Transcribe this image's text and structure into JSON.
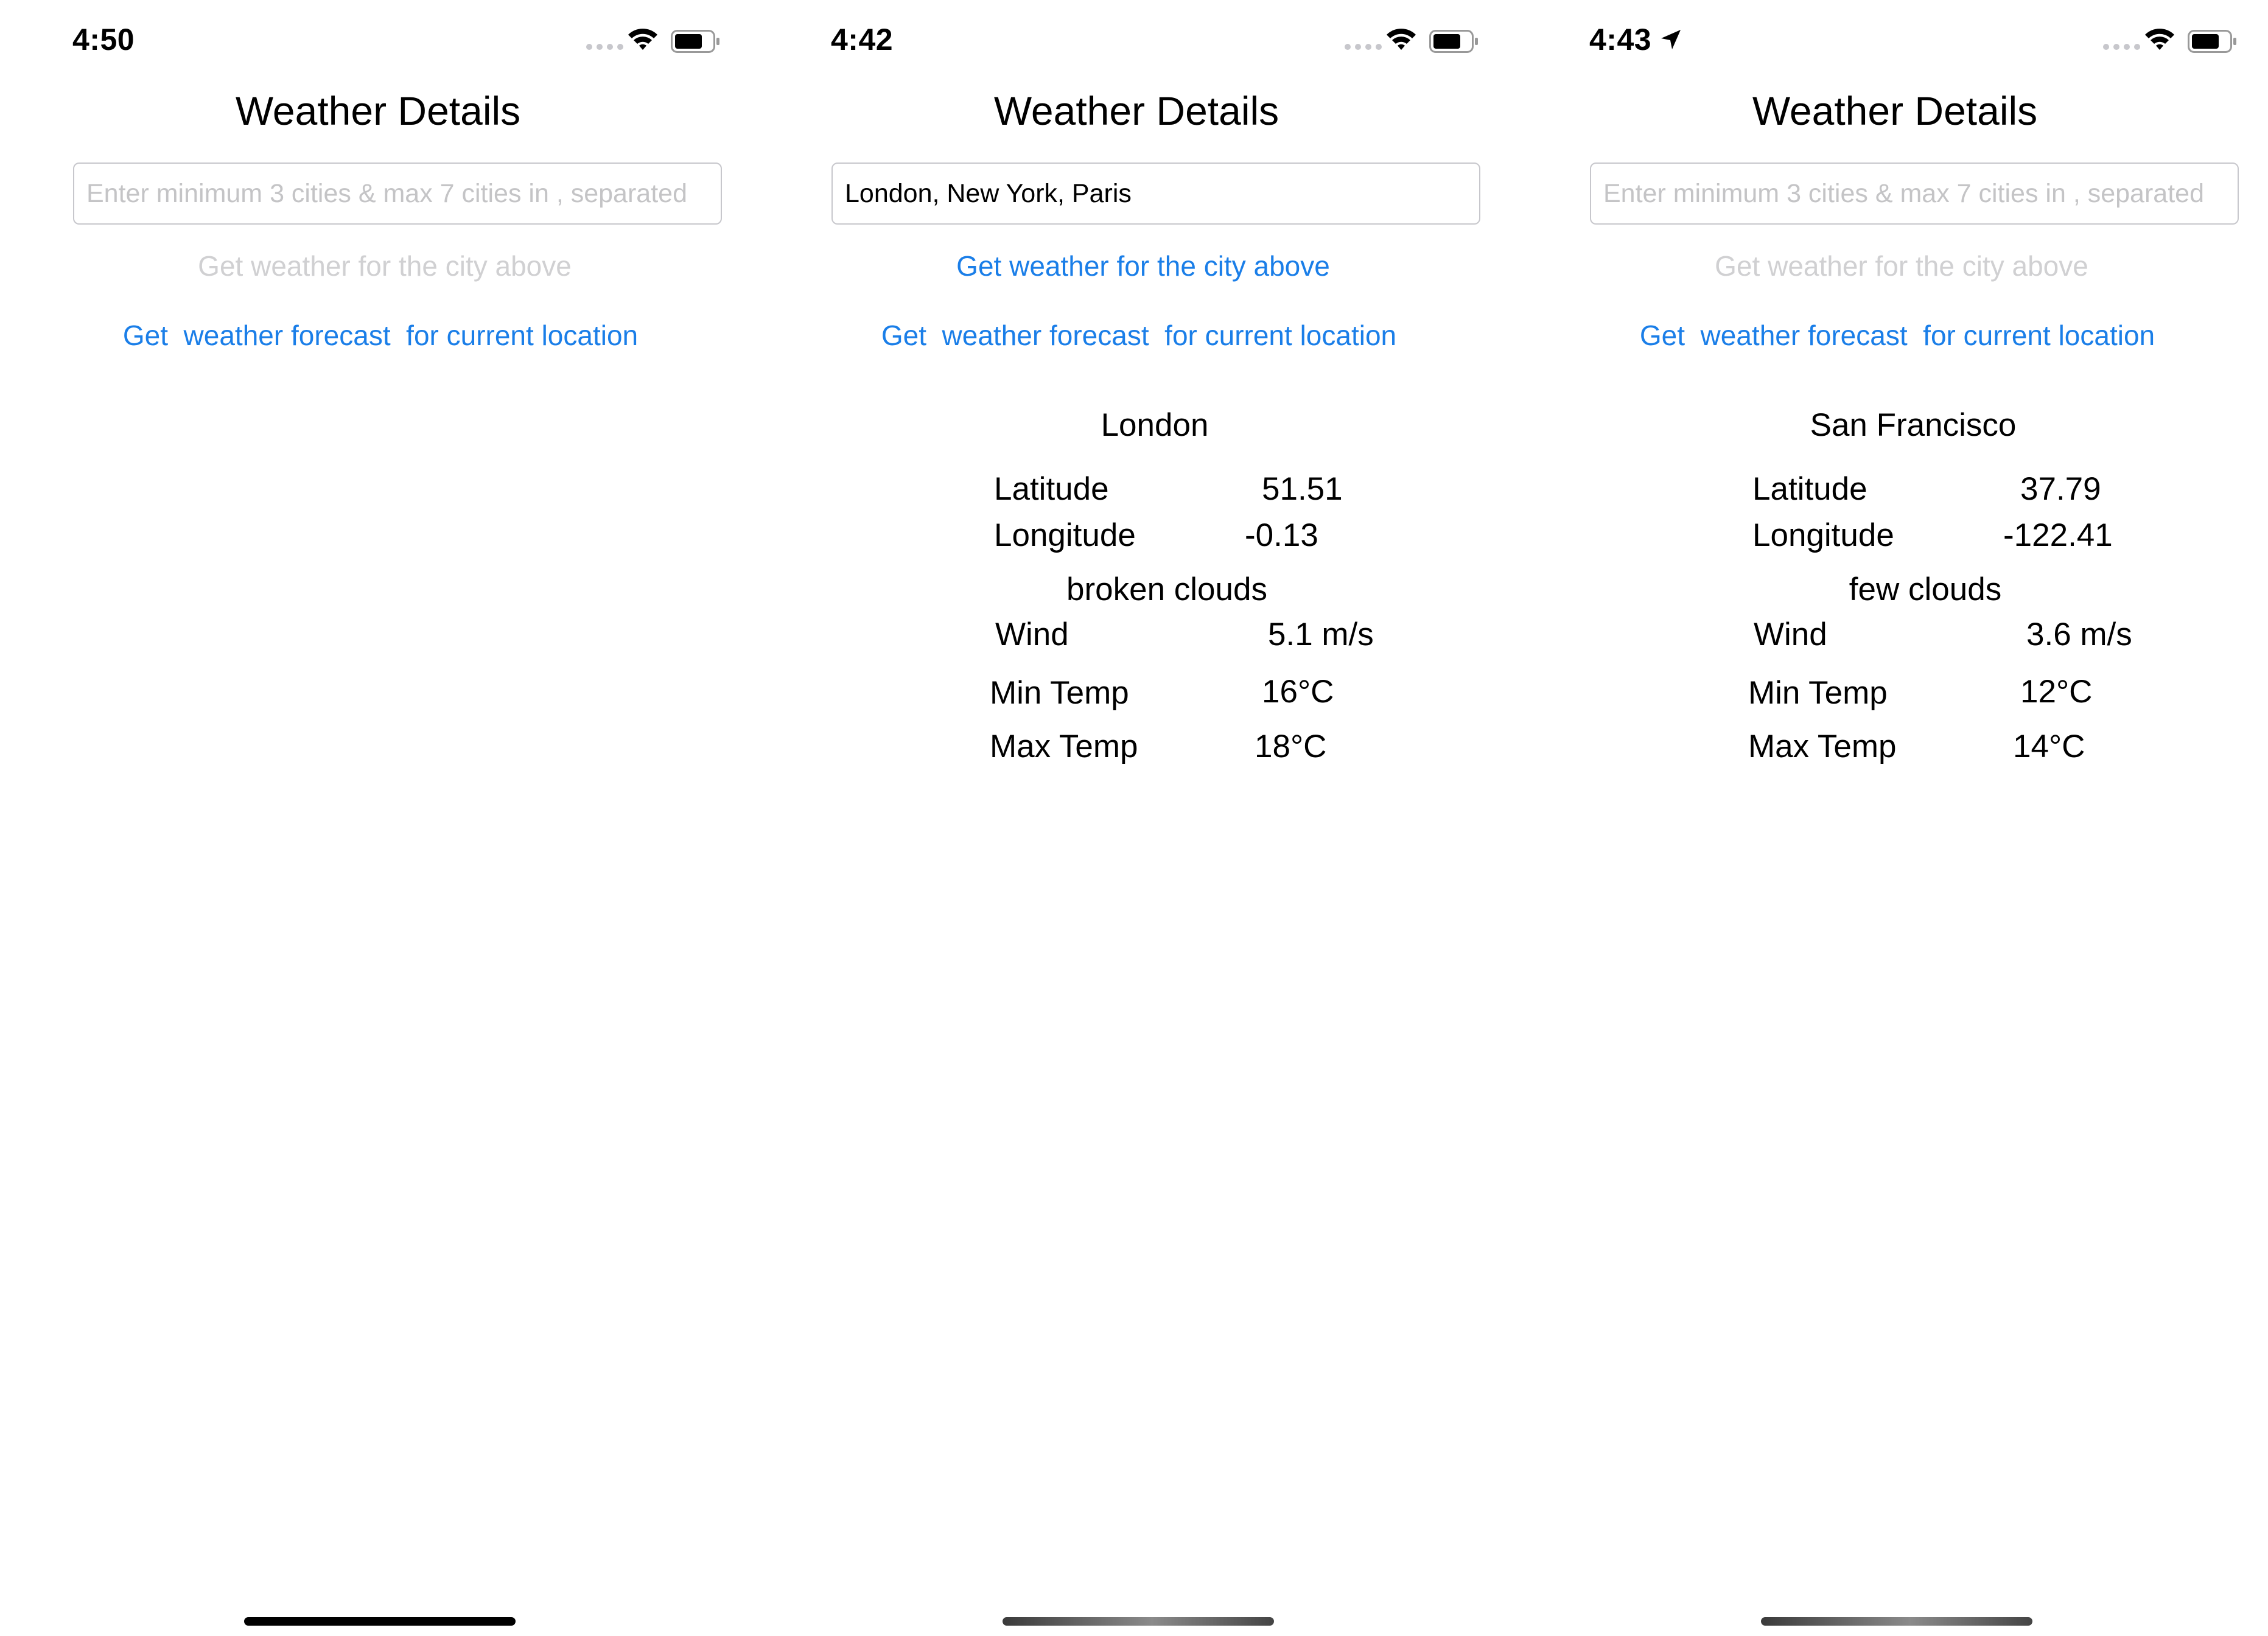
{
  "screens": [
    {
      "status": {
        "time": "4:50",
        "location_arrow": false
      },
      "title": "Weather Details",
      "city_input": {
        "value": "",
        "placeholder": "Enter minimum 3 cities & max 7 cities in , separated"
      },
      "city_button": {
        "label": "Get weather for the city above",
        "enabled": false
      },
      "location_button": {
        "label": "Get  weather forecast  for current location"
      },
      "weather": null
    },
    {
      "status": {
        "time": "4:42",
        "location_arrow": false
      },
      "title": "Weather Details",
      "city_input": {
        "value": "London, New York, Paris",
        "placeholder": "Enter minimum 3 cities & max 7 cities in , separated"
      },
      "city_button": {
        "label": "Get weather for the city above",
        "enabled": true
      },
      "location_button": {
        "label": "Get  weather forecast  for current location"
      },
      "weather": {
        "city": "London",
        "latitude_label": "Latitude",
        "latitude": "51.51",
        "longitude_label": "Longitude",
        "longitude": "-0.13",
        "description": "broken clouds",
        "wind_label": "Wind",
        "wind": "5.1 m/s",
        "min_temp_label": "Min Temp",
        "min_temp": "16°C",
        "max_temp_label": "Max Temp",
        "max_temp": "18°C"
      }
    },
    {
      "status": {
        "time": "4:43",
        "location_arrow": true
      },
      "title": "Weather Details",
      "city_input": {
        "value": "",
        "placeholder": "Enter minimum 3 cities & max 7 cities in , separated"
      },
      "city_button": {
        "label": "Get weather for the city above",
        "enabled": false
      },
      "location_button": {
        "label": "Get  weather forecast  for current location"
      },
      "weather": {
        "city": "San Francisco",
        "latitude_label": "Latitude",
        "latitude": "37.79",
        "longitude_label": "Longitude",
        "longitude": "-122.41",
        "description": "few clouds",
        "wind_label": "Wind",
        "wind": "3.6 m/s",
        "min_temp_label": "Min Temp",
        "min_temp": "12°C",
        "max_temp_label": "Max Temp",
        "max_temp": "14°C"
      }
    }
  ],
  "icons": {
    "signal": "cellular-signal-icon",
    "wifi": "wifi-icon",
    "battery": "battery-icon",
    "location": "location-arrow-icon"
  },
  "colors": {
    "link_blue": "#1a7ee8",
    "disabled_grey": "#d0d0d2",
    "placeholder_grey": "#c4c4c6",
    "border_grey": "#c7c7cc"
  }
}
